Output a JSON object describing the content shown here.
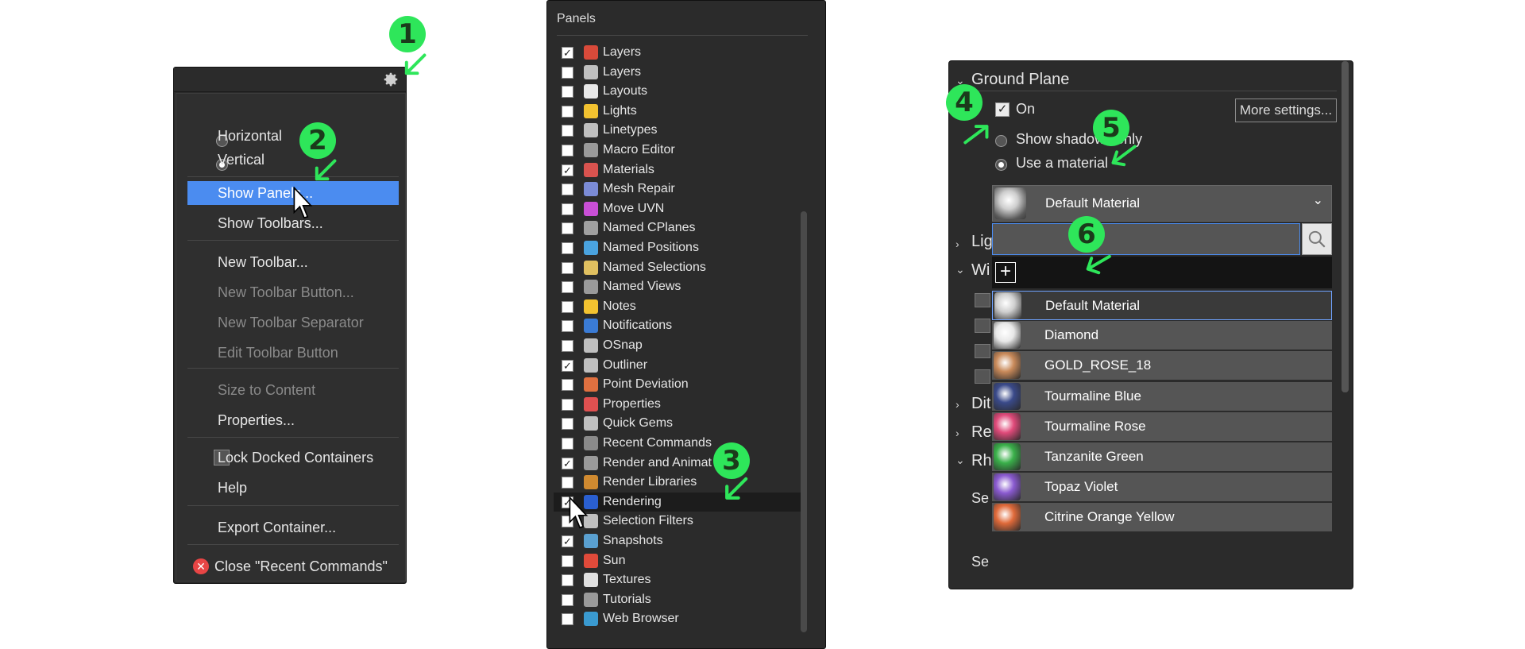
{
  "context_menu": {
    "items": [
      {
        "label": "Horizontal",
        "type": "radio",
        "checked": false,
        "disabled": false
      },
      {
        "label": "Vertical",
        "type": "radio",
        "checked": true,
        "disabled": false
      },
      {
        "label": "Show Panels...",
        "type": "item",
        "highlighted": true,
        "disabled": false
      },
      {
        "label": "Show Toolbars...",
        "type": "item",
        "disabled": false
      },
      {
        "label": "New Toolbar...",
        "type": "item",
        "disabled": false
      },
      {
        "label": "New Toolbar Button...",
        "type": "item",
        "disabled": true
      },
      {
        "label": "New Toolbar Separator",
        "type": "item",
        "disabled": true
      },
      {
        "label": "Edit Toolbar Button",
        "type": "item",
        "disabled": true
      },
      {
        "label": "Size to Content",
        "type": "item",
        "disabled": true
      },
      {
        "label": "Properties...",
        "type": "item",
        "disabled": false
      },
      {
        "label": "Lock Docked Containers",
        "type": "checkbox",
        "checked": false,
        "disabled": false
      },
      {
        "label": "Help",
        "type": "item",
        "disabled": false
      },
      {
        "label": "Export Container...",
        "type": "item",
        "disabled": false
      },
      {
        "label": "Close \"Recent Commands\"",
        "type": "close",
        "disabled": false
      }
    ],
    "highlight_color": "#4b8cf0"
  },
  "panels_list": {
    "title": "Panels",
    "items": [
      {
        "label": "Layers",
        "checked": true,
        "icon": "layers-icon",
        "color": "#d94a3a"
      },
      {
        "label": "Layers",
        "checked": false,
        "icon": "layers-icon",
        "color": "#bfbfbf"
      },
      {
        "label": "Layouts",
        "checked": false,
        "icon": "layouts-icon",
        "color": "#e8e8e8"
      },
      {
        "label": "Lights",
        "checked": false,
        "icon": "lights-icon",
        "color": "#f2c230"
      },
      {
        "label": "Linetypes",
        "checked": false,
        "icon": "linetypes-icon",
        "color": "#bfbfbf"
      },
      {
        "label": "Macro Editor",
        "checked": false,
        "icon": "macro-editor-icon",
        "color": "#9a9a9a"
      },
      {
        "label": "Materials",
        "checked": true,
        "icon": "materials-icon",
        "color": "#d9534f"
      },
      {
        "label": "Mesh Repair",
        "checked": false,
        "icon": "mesh-repair-icon",
        "color": "#7b8bd6"
      },
      {
        "label": "Move UVN",
        "checked": false,
        "icon": "move-uvn-icon",
        "color": "#c94fd6"
      },
      {
        "label": "Named CPlanes",
        "checked": false,
        "icon": "named-cplanes-icon",
        "color": "#a0a0a0"
      },
      {
        "label": "Named Positions",
        "checked": false,
        "icon": "named-positions-icon",
        "color": "#4aa3df"
      },
      {
        "label": "Named Selections",
        "checked": false,
        "icon": "named-selections-icon",
        "color": "#e0c060"
      },
      {
        "label": "Named Views",
        "checked": false,
        "icon": "named-views-icon",
        "color": "#9a9a9a"
      },
      {
        "label": "Notes",
        "checked": false,
        "icon": "notes-icon",
        "color": "#f2c230"
      },
      {
        "label": "Notifications",
        "checked": false,
        "icon": "notifications-icon",
        "color": "#3a7bd5"
      },
      {
        "label": "OSnap",
        "checked": false,
        "icon": "osnap-icon",
        "color": "#bfbfbf"
      },
      {
        "label": "Outliner",
        "checked": true,
        "icon": "outliner-icon",
        "color": "#bfbfbf"
      },
      {
        "label": "Point Deviation",
        "checked": false,
        "icon": "point-deviation-icon",
        "color": "#e07040"
      },
      {
        "label": "Properties",
        "checked": false,
        "icon": "properties-icon",
        "color": "#e05050"
      },
      {
        "label": "Quick Gems",
        "checked": false,
        "icon": "quick-gems-icon",
        "color": "#bfbfbf"
      },
      {
        "label": "Recent Commands",
        "checked": false,
        "icon": "recent-commands-icon",
        "color": "#8a8a8a"
      },
      {
        "label": "Render and Animat",
        "checked": true,
        "icon": "render-animation-icon",
        "color": "#9a9a9a"
      },
      {
        "label": "Render Libraries",
        "checked": false,
        "icon": "render-libraries-icon",
        "color": "#d08a30"
      },
      {
        "label": "Rendering",
        "checked": true,
        "icon": "rendering-icon",
        "color": "#2a5fd0",
        "selected": true
      },
      {
        "label": "Selection Filters",
        "checked": false,
        "icon": "selection-filters-icon",
        "color": "#bfbfbf"
      },
      {
        "label": "Snapshots",
        "checked": true,
        "icon": "snapshots-icon",
        "color": "#5aa0d0"
      },
      {
        "label": "Sun",
        "checked": false,
        "icon": "sun-icon",
        "color": "#e04a3a"
      },
      {
        "label": "Textures",
        "checked": false,
        "icon": "textures-icon",
        "color": "#e0e0e0"
      },
      {
        "label": "Tutorials",
        "checked": false,
        "icon": "tutorials-icon",
        "color": "#9a9a9a"
      },
      {
        "label": "Web Browser",
        "checked": false,
        "icon": "web-browser-icon",
        "color": "#3a9ad0"
      }
    ]
  },
  "ground_plane": {
    "section_title": "Ground Plane",
    "on_label": "On",
    "on_checked": true,
    "more_settings_label": "More settings...",
    "show_shadows_label": "Show shadows only",
    "use_material_label": "Use a material",
    "selected_material": "Default Material",
    "collapsed_sections": [
      "Lig",
      "Wi",
      "Dit",
      "Re",
      "Rh"
    ],
    "cut_labels": [
      "Se",
      "Se"
    ],
    "add_label": "+",
    "materials": [
      {
        "name": "Default Material",
        "color": "#cfcfcf",
        "selected": true
      },
      {
        "name": "Diamond",
        "color": "#e8e8e8"
      },
      {
        "name": "GOLD_ROSE_18",
        "color": "#c98a5a"
      },
      {
        "name": "Tourmaline Blue",
        "color": "#3a4a8a"
      },
      {
        "name": "Tourmaline Rose",
        "color": "#e04a7a"
      },
      {
        "name": "Tanzanite Green",
        "color": "#3ab04a"
      },
      {
        "name": "Topaz Violet",
        "color": "#8a5ad0"
      },
      {
        "name": "Citrine Orange Yellow",
        "color": "#e06a3a"
      }
    ]
  },
  "annotations": [
    "1",
    "2",
    "3",
    "4",
    "5",
    "6"
  ],
  "annotation_color": "#2ee65a"
}
